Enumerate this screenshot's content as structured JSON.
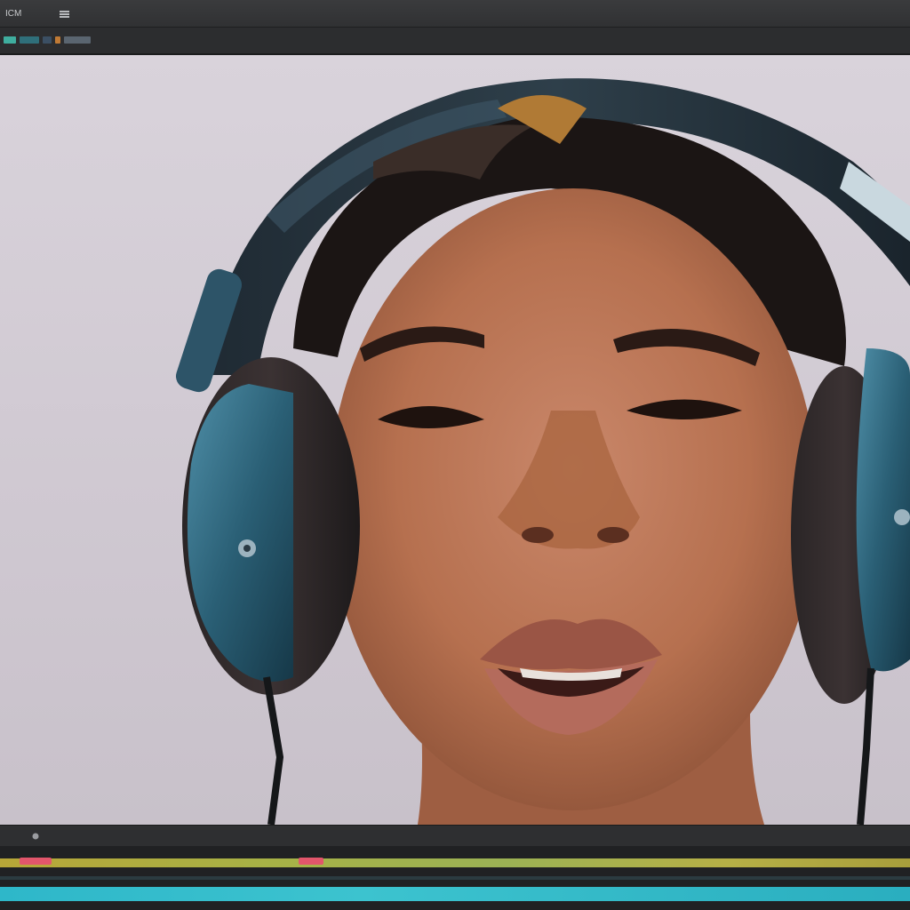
{
  "window": {
    "title": "ICM"
  },
  "icons": {
    "menu": "menu-icon",
    "timeline_tool": "playhead-icon"
  },
  "toolbar": {
    "buttons": [
      {
        "icon": "tool-swatch-1",
        "color": "#3fae9f"
      },
      {
        "icon": "tool-swatch-2",
        "color": "#2f6f7a"
      },
      {
        "icon": "tool-swatch-3",
        "color": "#3b4f63"
      },
      {
        "icon": "tool-swatch-4",
        "color": "#c07a35"
      },
      {
        "icon": "tool-swatch-5",
        "color": "#5a6570"
      }
    ]
  },
  "colors": {
    "chrome_dark": "#2a2b2d",
    "timeline_video": "#2eb7c9",
    "timeline_audio": "#c8b53a",
    "marker_red": "#e2566b",
    "headphone_teal": "#2f6c86"
  }
}
